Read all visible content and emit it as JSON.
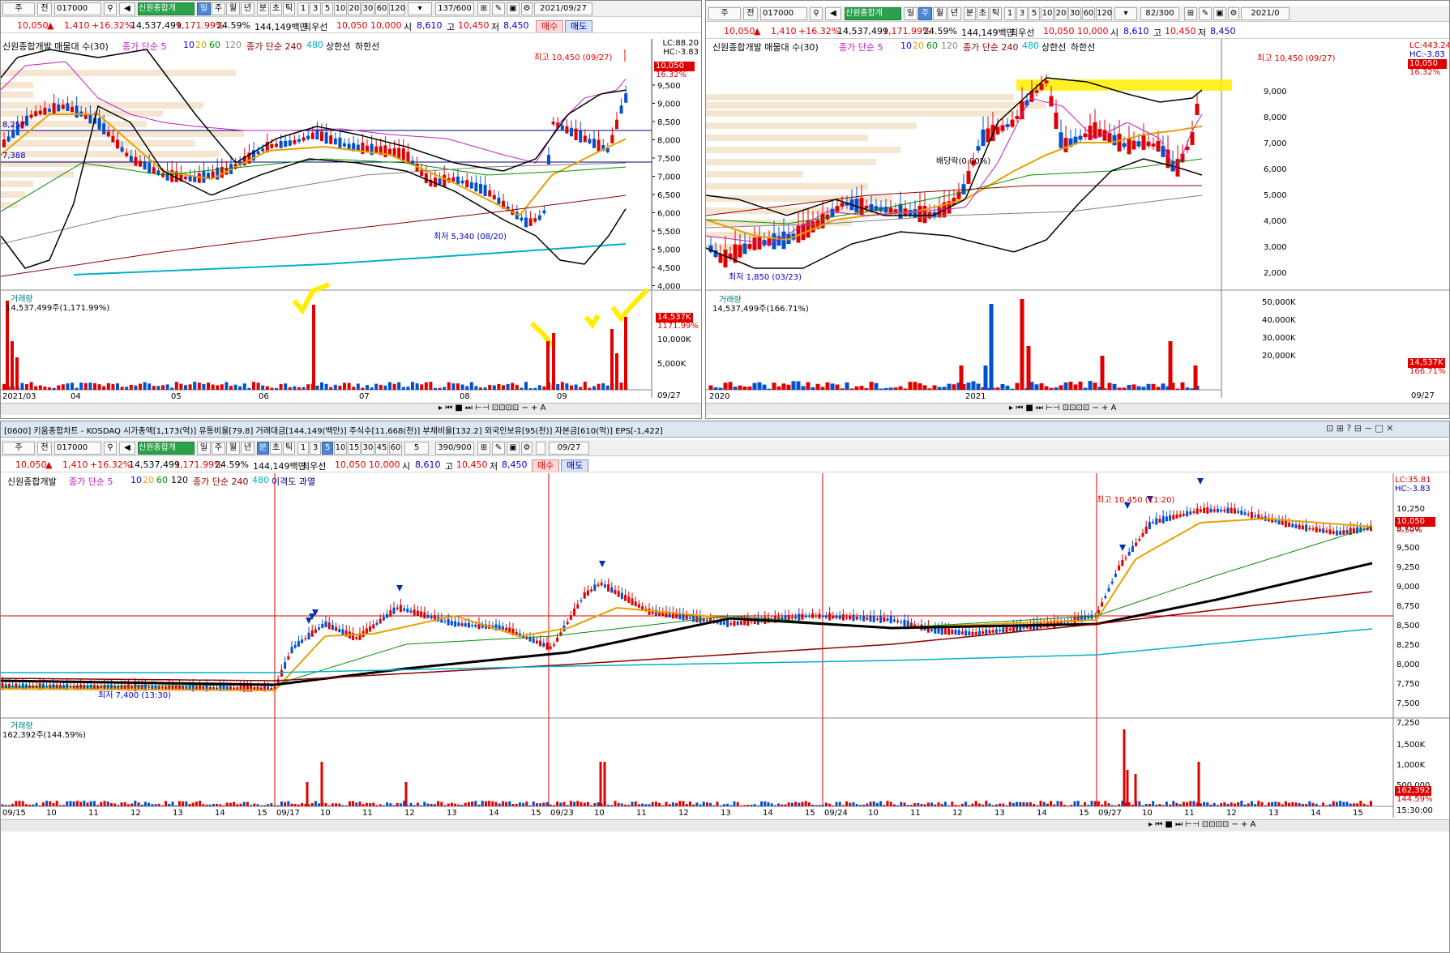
{
  "common": {
    "type_sel": "주",
    "prev": "전",
    "code": "017000",
    "stock_name": "신원종합개",
    "periods": [
      "일",
      "주",
      "월",
      "년"
    ],
    "units": [
      "분",
      "초",
      "틱"
    ],
    "nums": [
      "1",
      "3",
      "5",
      "10",
      "20",
      "30",
      "60",
      "120"
    ],
    "price": "10,050",
    "change": "1,410",
    "change_pct": "+16.32%",
    "volume": "14,537,499",
    "volume_pct": "1,171.99%",
    "turnover": "24.59%",
    "amount": "144,149백만",
    "bid_label": "최우선",
    "bid1": "10,050",
    "bid2": "10,000",
    "open_lbl": "시",
    "open": "8,610",
    "high_lbl": "고",
    "high": "10,450",
    "low_lbl": "저",
    "low": "8,450",
    "buy": "매수",
    "sell": "매도"
  },
  "panel1": {
    "count": "137/600",
    "date": "2021/09/27",
    "legend": {
      "name": "신원종합개발 매물대 수(30)",
      "ma_label": "종가 단순 5",
      "ma10": "10",
      "ma20": "20",
      "ma60": "60",
      "ma120": "120",
      "ma_label2": "종가 단순 240",
      "ma480": "480",
      "upper": "상한선",
      "lower": "하한선"
    },
    "lc": "LC:88.20",
    "hc": "HC:-3.83",
    "last_tag": "10,050",
    "last_pct": "16.32%",
    "yticks": [
      "9,500",
      "9,000",
      "8,500",
      "8,000",
      "7,500",
      "7,000",
      "6,500",
      "6,000",
      "5,500",
      "5,000",
      "4,500",
      "4,000"
    ],
    "hi_note": "최고 10,450 (09/27)",
    "lo_note": "최저 5,340 (08/20)",
    "level1": "8,257",
    "level2": "7,388",
    "vol_title": "거래량",
    "vol_text": "14,537,499주(1,171.99%)",
    "vol_tag": "14,537K",
    "vol_pct": "1171.99%",
    "vticks": [
      "10,000K",
      "5,000K"
    ],
    "xlabels": [
      "2021/03",
      "04",
      "05",
      "06",
      "07",
      "08",
      "09"
    ],
    "xlast": "09/27"
  },
  "panel2": {
    "count": "82/300",
    "date": "2021/0",
    "legend": {
      "name": "신원종합개발 매물대 수(30)",
      "ma_label": "종가 단순 5",
      "ma10": "10",
      "ma20": "20",
      "ma60": "60",
      "ma120": "120",
      "ma_label2": "종가 단순 240",
      "ma480": "480",
      "upper": "상한선",
      "lower": "하한선"
    },
    "lc": "LC:443.24",
    "hc": "HC:-3.83",
    "last_tag": "10,050",
    "last_pct": "16.32%",
    "yticks": [
      "9,000",
      "8,000",
      "7,000",
      "6,000",
      "5,000",
      "4,000",
      "3,000",
      "2,000"
    ],
    "hi_note": "최고 10,450 (09/27)",
    "lo_note": "최저 1,850 (03/23)",
    "div_note": "배당락(0.00%)",
    "vol_title": "거래량",
    "vol_text": "14,537,499주(166.71%)",
    "vol_tag": "14,537K",
    "vol_pct": "166.71%",
    "vticks": [
      "50,000K",
      "40,000K",
      "30,000K",
      "20,000K"
    ],
    "xlabels": [
      "2020",
      "2021"
    ],
    "xlast": "09/27"
  },
  "panel3": {
    "window_title": "[0600] 키움종합차트 - KOSDAQ 시가총액[1,173(억)] 유통비율[79.8] 거래대금[144,149(백만)] 주식수[11,668(천)] 부채비율[132.2] 외국인보유[95(천)] 자본금[610(억)] EPS[-1,422]",
    "count": "390/900",
    "date": "09/27",
    "min_sel": "5",
    "nums3": [
      "1",
      "3",
      "5",
      "10",
      "15",
      "30",
      "45",
      "60"
    ],
    "legend": {
      "name": "신원종합개발",
      "ma_label": "종가 단순 5",
      "ma10": "10",
      "ma20": "20",
      "ma60": "60",
      "ma120": "120",
      "ma_label2": "종가 단순 240",
      "ma480": "480",
      "extra": "이격도 과열"
    },
    "lc": "LC:35.81",
    "hc": "HC:-3.83",
    "last_tag": "10,050",
    "last_pct": "0.50%",
    "yticks": [
      "10,250",
      "9,750",
      "9,500",
      "9,250",
      "9,000",
      "8,750",
      "8,500",
      "8,250",
      "8,000",
      "7,750",
      "7,500",
      "7,250"
    ],
    "hi_note": "최고 10,450 (11:20)",
    "lo_note": "최저 7,400 (13:30)",
    "vol_title": "거래량",
    "vol_text": "162,392주(144.59%)",
    "vol_tag": "162,392",
    "vol_pct": "144.59%",
    "vticks": [
      "1,500K",
      "1,000K",
      "500,000"
    ],
    "xlabels": [
      "09/15",
      "10",
      "11",
      "12",
      "13",
      "14",
      "15",
      "09/17",
      "10",
      "11",
      "12",
      "13",
      "14",
      "15",
      "09/23",
      "10",
      "11",
      "12",
      "13",
      "14",
      "15",
      "09/24",
      "10",
      "11",
      "12",
      "13",
      "14",
      "15",
      "09/27",
      "10",
      "11",
      "12",
      "13",
      "14",
      "15"
    ],
    "xlast": "15:30:00"
  }
}
